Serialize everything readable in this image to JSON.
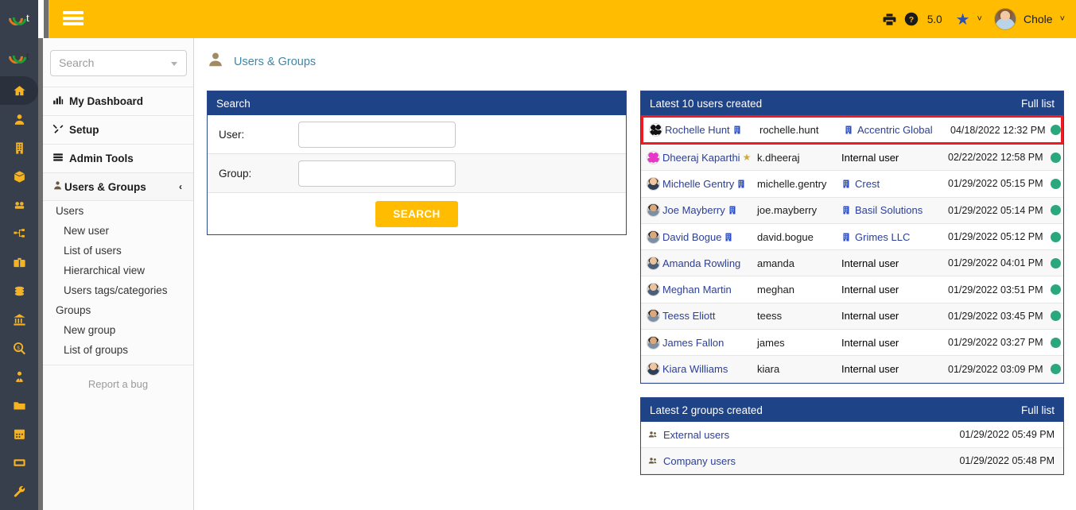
{
  "topbar": {
    "menu_icon": "hamburger-icon",
    "print_icon": "printer-icon",
    "help_icon": "question-circle-icon",
    "version": "5.0",
    "star_icon": "star-icon",
    "star_chevron": "˅",
    "user_name": "Chole",
    "user_chevron": "˅"
  },
  "icon_rail": {
    "items": [
      {
        "name": "home-icon",
        "active": true
      },
      {
        "name": "user-icon",
        "active": false
      },
      {
        "name": "building-icon",
        "active": false
      },
      {
        "name": "box-icon",
        "active": false
      },
      {
        "name": "cubes-icon",
        "active": false
      },
      {
        "name": "sitemap-icon",
        "active": false
      },
      {
        "name": "briefcase-icon",
        "active": false
      },
      {
        "name": "coins-icon",
        "active": false
      },
      {
        "name": "bank-icon",
        "active": false
      },
      {
        "name": "search-dollar-icon",
        "active": false
      },
      {
        "name": "user-tie-icon",
        "active": false
      },
      {
        "name": "folder-icon",
        "active": false
      },
      {
        "name": "calendar-icon",
        "active": false
      },
      {
        "name": "ticket-icon",
        "active": false
      },
      {
        "name": "wrench-icon",
        "active": false
      }
    ]
  },
  "sidebar": {
    "search_placeholder": "Search",
    "menu": [
      {
        "label": "My Dashboard",
        "icon": "chart-bar-icon"
      },
      {
        "label": "Setup",
        "icon": "tools-icon"
      },
      {
        "label": "Admin Tools",
        "icon": "server-icon"
      }
    ],
    "active_section": {
      "label": "Users & Groups",
      "icon": "user-icon",
      "chevron": "‹"
    },
    "sub_items": [
      {
        "label": "Users",
        "level": "group"
      },
      {
        "label": "New user",
        "level": "leaf"
      },
      {
        "label": "List of users",
        "level": "leaf"
      },
      {
        "label": "Hierarchical view",
        "level": "leaf"
      },
      {
        "label": "Users tags/categories",
        "level": "leaf"
      },
      {
        "label": "Groups",
        "level": "group"
      },
      {
        "label": "New group",
        "level": "leaf"
      },
      {
        "label": "List of groups",
        "level": "leaf"
      }
    ],
    "report_bug": "Report a bug"
  },
  "breadcrumb": {
    "icon": "user-icon",
    "label": "Users & Groups"
  },
  "search_panel": {
    "title": "Search",
    "user_label": "User:",
    "user_value": "",
    "group_label": "Group:",
    "group_value": "",
    "button_label": "SEARCH"
  },
  "users_panel": {
    "title": "Latest 10 users created",
    "full_list": "Full list",
    "rows": [
      {
        "name": "Rochelle Hunt",
        "avatar": "av-ident-dark",
        "name_badge": "building-icon",
        "login": "rochelle.hunt",
        "org": "Accentric Global",
        "org_icon": "building-icon",
        "date": "04/18/2022 12:32 PM",
        "status": "active",
        "highlight": true
      },
      {
        "name": "Dheeraj Kaparthi",
        "avatar": "av-ident-pink",
        "name_badge": "star-icon",
        "login": "k.dheeraj",
        "org": "Internal user",
        "org_icon": "",
        "date": "02/22/2022 12:58 PM",
        "status": "active",
        "highlight": false
      },
      {
        "name": "Michelle Gentry",
        "avatar": "av-photo-c",
        "name_badge": "building-icon",
        "login": "michelle.gentry",
        "org": "Crest",
        "org_icon": "building-icon",
        "date": "01/29/2022 05:15 PM",
        "status": "active",
        "highlight": false
      },
      {
        "name": "Joe Mayberry",
        "avatar": "av-photo-b",
        "name_badge": "building-icon",
        "login": "joe.mayberry",
        "org": "Basil Solutions",
        "org_icon": "building-icon",
        "date": "01/29/2022 05:14 PM",
        "status": "active",
        "highlight": false
      },
      {
        "name": "David Bogue",
        "avatar": "av-photo-b",
        "name_badge": "building-icon",
        "login": "david.bogue",
        "org": "Grimes LLC",
        "org_icon": "building-icon",
        "date": "01/29/2022 05:12 PM",
        "status": "active",
        "highlight": false
      },
      {
        "name": "Amanda Rowling",
        "avatar": "av-photo-a",
        "name_badge": "",
        "login": "amanda",
        "org": "Internal user",
        "org_icon": "",
        "date": "01/29/2022 04:01 PM",
        "status": "active",
        "highlight": false
      },
      {
        "name": "Meghan Martin",
        "avatar": "av-photo-a",
        "name_badge": "",
        "login": "meghan",
        "org": "Internal user",
        "org_icon": "",
        "date": "01/29/2022 03:51 PM",
        "status": "active",
        "highlight": false
      },
      {
        "name": "Teess Eliott",
        "avatar": "av-photo-b",
        "name_badge": "",
        "login": "teess",
        "org": "Internal user",
        "org_icon": "",
        "date": "01/29/2022 03:45 PM",
        "status": "active",
        "highlight": false
      },
      {
        "name": "James Fallon",
        "avatar": "av-photo-b",
        "name_badge": "",
        "login": "james",
        "org": "Internal user",
        "org_icon": "",
        "date": "01/29/2022 03:27 PM",
        "status": "active",
        "highlight": false
      },
      {
        "name": "Kiara Williams",
        "avatar": "av-photo-c",
        "name_badge": "",
        "login": "kiara",
        "org": "Internal user",
        "org_icon": "",
        "date": "01/29/2022 03:09 PM",
        "status": "active",
        "highlight": false
      }
    ]
  },
  "groups_panel": {
    "title": "Latest 2 groups created",
    "full_list": "Full list",
    "rows": [
      {
        "name": "External users",
        "icon": "users-icon",
        "date": "01/29/2022 05:49 PM"
      },
      {
        "name": "Company users",
        "icon": "users-icon",
        "date": "01/29/2022 05:48 PM"
      }
    ]
  },
  "colors": {
    "topbar": "#ffbc00",
    "panel_header": "#1f4387",
    "rail": "#373f4d",
    "rail_icon": "#f5b324",
    "link": "#2b3f96",
    "breadcrumb": "#3d87a8",
    "status_active": "#2aa77c",
    "highlight_border": "#ed1c24"
  }
}
